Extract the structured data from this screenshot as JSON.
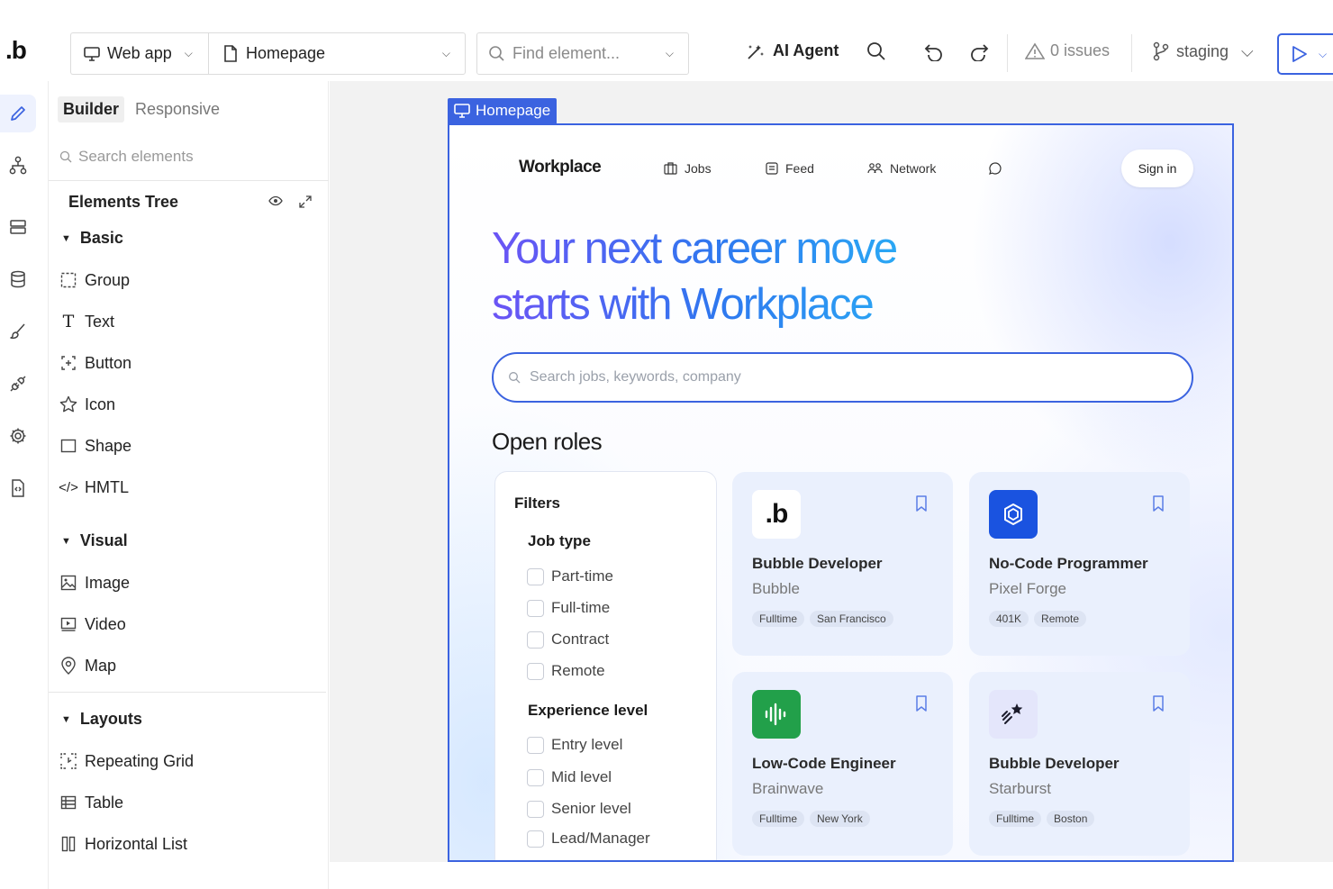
{
  "topbar": {
    "logo": ".b",
    "app_type": "Web app",
    "page": "Homepage",
    "find_placeholder": "Find element...",
    "ai_agent": "AI Agent",
    "issues": "0 issues",
    "branch": "staging"
  },
  "rail": {
    "icons": [
      "pencil-icon",
      "sitemap-icon",
      "server-icon",
      "database-icon",
      "brush-icon",
      "plug-icon",
      "gear-icon",
      "file-code-icon"
    ]
  },
  "panel": {
    "tabs": [
      "Builder",
      "Responsive"
    ],
    "search_placeholder": "Search elements",
    "tree_title": "Elements Tree",
    "groups": [
      {
        "name": "Basic",
        "items": [
          "Group",
          "Text",
          "Button",
          "Icon",
          "Shape",
          "HMTL"
        ]
      },
      {
        "name": "Visual",
        "items": [
          "Image",
          "Video",
          "Map"
        ]
      },
      {
        "name": "Layouts",
        "items": [
          "Repeating Grid",
          "Table",
          "Horizontal List"
        ]
      }
    ]
  },
  "canvas": {
    "tag": "Homepage",
    "nav": {
      "brand": "Workplace",
      "links": [
        "Jobs",
        "Feed",
        "Network"
      ],
      "signin": "Sign in"
    },
    "hero_line1": "Your next career move",
    "hero_line2": "starts with Workplace",
    "search_placeholder": "Search jobs, keywords, company",
    "open_roles": "Open roles",
    "filters": {
      "title": "Filters",
      "job_type_label": "Job type",
      "job_types": [
        "Part-time",
        "Full-time",
        "Contract",
        "Remote"
      ],
      "experience_label": "Experience level",
      "experience": [
        "Entry level",
        "Mid level",
        "Senior level",
        "Lead/Manager"
      ]
    },
    "jobs": [
      {
        "title": "Bubble Developer",
        "company": "Bubble",
        "tags": [
          "Fulltime",
          "San Francisco"
        ],
        "logo": ".b",
        "logo_bg": "#ffffff"
      },
      {
        "title": "No-Code Programmer",
        "company": "Pixel Forge",
        "tags": [
          "401K",
          "Remote"
        ],
        "logo": "cube-icon",
        "logo_bg": "#1a53e0"
      },
      {
        "title": "Low-Code Engineer",
        "company": "Brainwave",
        "tags": [
          "Fulltime",
          "New York"
        ],
        "logo": "waveform-icon",
        "logo_bg": "#22a04a"
      },
      {
        "title": "Bubble Developer",
        "company": "Starburst",
        "tags": [
          "Fulltime",
          "Boston"
        ],
        "logo": "shooting-star-icon",
        "logo_bg": "#e4e6fb"
      }
    ]
  },
  "colors": {
    "accent": "#3b63e0",
    "hero_gradient_start": "#6b54f5",
    "hero_gradient_end": "#2aa7f4",
    "card_bg": "#eaf0fd"
  }
}
